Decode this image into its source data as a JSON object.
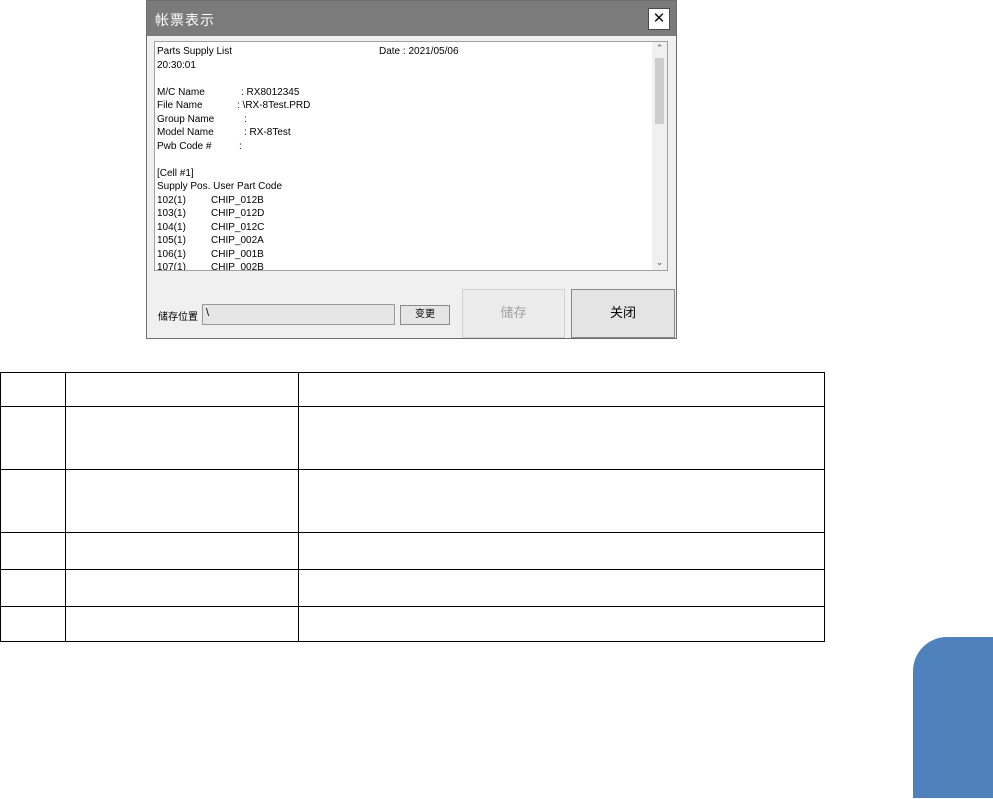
{
  "dialog": {
    "title": "帐票表示",
    "close_glyph": "✕",
    "report_lines": [
      {
        "a": "Parts Supply List",
        "b": "Date : 2021/05/06"
      },
      {
        "a": "20:30:01",
        "b": ""
      },
      {
        "a": "",
        "b": ""
      },
      {
        "a": "M/C Name",
        "b": ": RX8012345"
      },
      {
        "a": "File Name",
        "b": ": \\RX-8Test.PRD"
      },
      {
        "a": "Group Name",
        "b": ":"
      },
      {
        "a": "Model Name",
        "b": ": RX-8Test"
      },
      {
        "a": "Pwb Code #",
        "b": ":"
      },
      {
        "a": "",
        "b": ""
      },
      {
        "a": "[Cell #1]",
        "b": ""
      },
      {
        "a": "Supply Pos.  User Part Code",
        "b": ""
      },
      {
        "a": "102(1)",
        "b": "CHIP_012B"
      },
      {
        "a": "103(1)",
        "b": "CHIP_012D"
      },
      {
        "a": "104(1)",
        "b": "CHIP_012C"
      },
      {
        "a": "105(1)",
        "b": "CHIP_002A"
      },
      {
        "a": "106(1)",
        "b": "CHIP_001B"
      },
      {
        "a": "107(1)",
        "b": "CHIP_002B"
      }
    ],
    "save_location_label": "储存位置",
    "save_location_value": "\\",
    "change_button": "变更",
    "save_button": "储存",
    "close_button": "关闭"
  },
  "table": {
    "rows": [
      [
        "",
        "",
        ""
      ],
      [
        "",
        "",
        ""
      ],
      [
        "",
        "",
        ""
      ],
      [
        "",
        "",
        ""
      ],
      [
        "",
        "",
        ""
      ],
      [
        "",
        "",
        ""
      ]
    ]
  },
  "colors": {
    "titlebar": "#7b7b7b",
    "side_tab": "#4f81bd"
  }
}
